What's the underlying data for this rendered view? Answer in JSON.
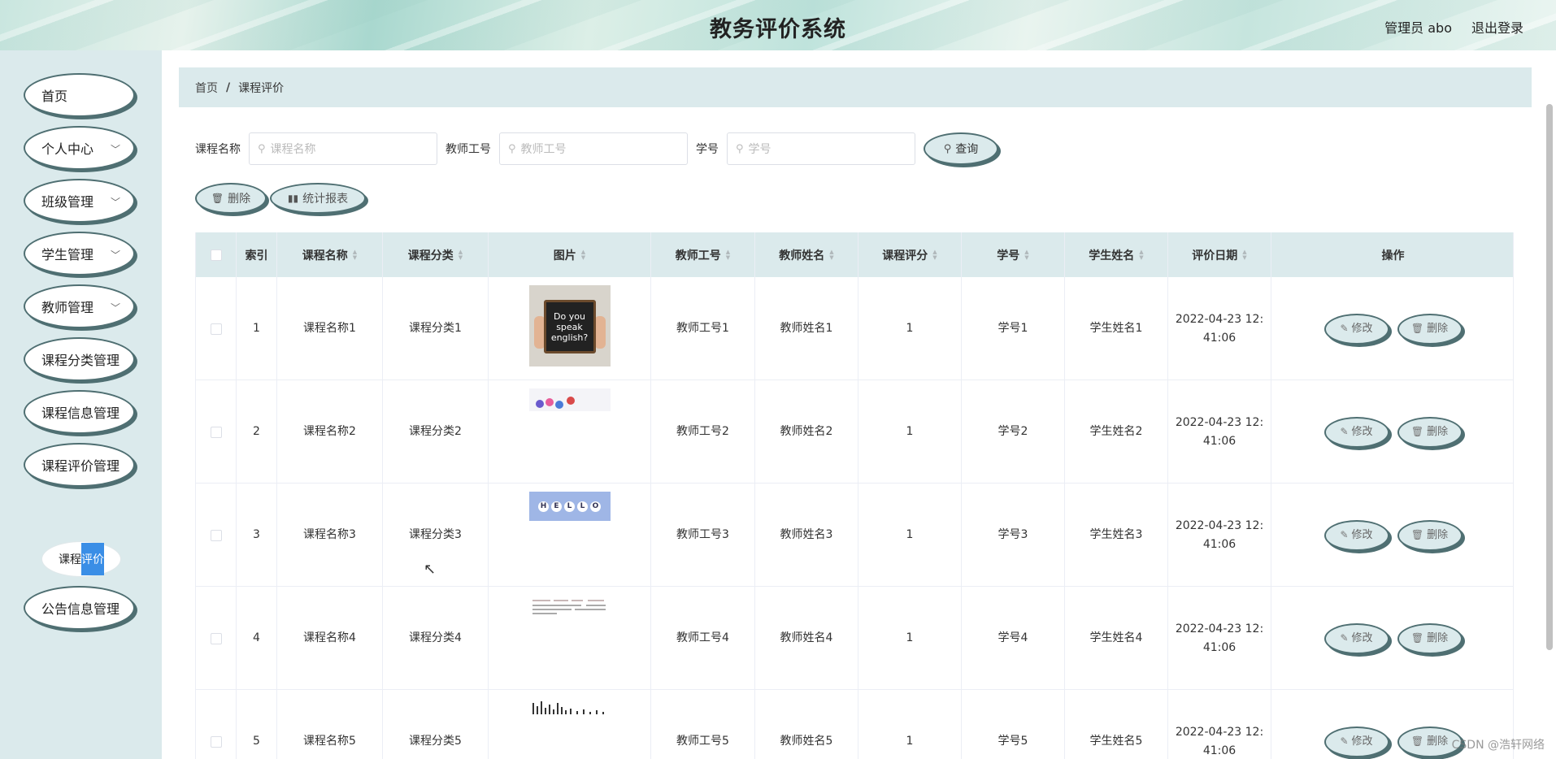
{
  "header": {
    "title": "教务评价系统",
    "user": "管理员 abo",
    "logout": "退出登录"
  },
  "sidebar": {
    "items": [
      {
        "label": "首页",
        "expandable": false
      },
      {
        "label": "个人中心",
        "expandable": true
      },
      {
        "label": "班级管理",
        "expandable": true
      },
      {
        "label": "学生管理",
        "expandable": true
      },
      {
        "label": "教师管理",
        "expandable": true
      },
      {
        "label": "课程分类管理",
        "expandable": false
      },
      {
        "label": "课程信息管理",
        "expandable": false
      },
      {
        "label": "课程评价管理",
        "expandable": false
      },
      {
        "label": "公告信息管理",
        "expandable": false
      }
    ],
    "submenu": {
      "prefix": "课程",
      "highlight": "评价"
    }
  },
  "breadcrumb": {
    "home": "首页",
    "separator": "/",
    "current": "课程评价"
  },
  "search": {
    "course_name_label": "课程名称",
    "course_name_placeholder": "课程名称",
    "teacher_no_label": "教师工号",
    "teacher_no_placeholder": "教师工号",
    "student_no_label": "学号",
    "student_no_placeholder": "学号",
    "query_button": "查询"
  },
  "actions": {
    "delete": "删除",
    "report": "统计报表"
  },
  "table": {
    "headers": [
      "索引",
      "课程名称",
      "课程分类",
      "图片",
      "教师工号",
      "教师姓名",
      "课程评分",
      "学号",
      "学生姓名",
      "评价日期",
      "操作"
    ],
    "rows": [
      {
        "index": "1",
        "course_name": "课程名称1",
        "course_category": "课程分类1",
        "teacher_no": "教师工号1",
        "teacher_name": "教师姓名1",
        "score": "1",
        "student_no": "学号1",
        "student_name": "学生姓名1",
        "date_line1": "2022-04-23 12:",
        "date_line2": "41:06"
      },
      {
        "index": "2",
        "course_name": "课程名称2",
        "course_category": "课程分类2",
        "teacher_no": "教师工号2",
        "teacher_name": "教师姓名2",
        "score": "1",
        "student_no": "学号2",
        "student_name": "学生姓名2",
        "date_line1": "2022-04-23 12:",
        "date_line2": "41:06"
      },
      {
        "index": "3",
        "course_name": "课程名称3",
        "course_category": "课程分类3",
        "teacher_no": "教师工号3",
        "teacher_name": "教师姓名3",
        "score": "1",
        "student_no": "学号3",
        "student_name": "学生姓名3",
        "date_line1": "2022-04-23 12:",
        "date_line2": "41:06"
      },
      {
        "index": "4",
        "course_name": "课程名称4",
        "course_category": "课程分类4",
        "teacher_no": "教师工号4",
        "teacher_name": "教师姓名4",
        "score": "1",
        "student_no": "学号4",
        "student_name": "学生姓名4",
        "date_line1": "2022-04-23 12:",
        "date_line2": "41:06"
      },
      {
        "index": "5",
        "course_name": "课程名称5",
        "course_category": "课程分类5",
        "teacher_no": "教师工号5",
        "teacher_name": "教师姓名5",
        "score": "1",
        "student_no": "学号5",
        "student_name": "学生姓名5",
        "date_line1": "2022-04-23 12:",
        "date_line2": "41:06"
      }
    ],
    "edit_label": "修改",
    "delete_label": "删除",
    "thumb1_text": "Do you speak english?",
    "thumb3_text": "HELLO"
  },
  "watermark": "CSDN @浩轩网络",
  "colors": {
    "accent": "#dbeaec",
    "border": "#4f6f72",
    "highlight": "#3a8ee6"
  }
}
